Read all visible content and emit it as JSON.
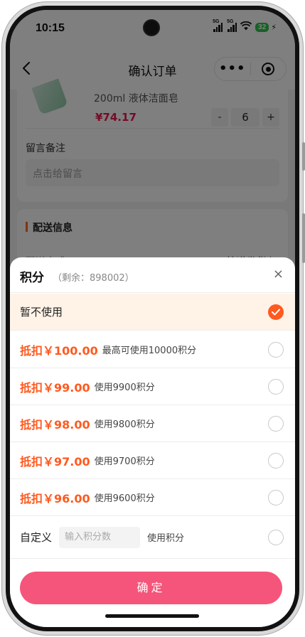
{
  "status_bar": {
    "time": "10:15",
    "network_1": "5G",
    "network_2": "5G",
    "battery": "32"
  },
  "nav": {
    "title": "确认订单",
    "more_label": "•••"
  },
  "background": {
    "product_name": "200ml 液体洁面皂",
    "product_price": "¥74.17",
    "quantity": "6",
    "minus": "-",
    "plus": "+",
    "remark_label": "留言备注",
    "remark_placeholder": "点击给留言",
    "delivery_section_title": "配送信息",
    "delivery_method_label": "配送方式",
    "delivery_method_value": "快递发货 〉"
  },
  "sheet": {
    "title": "积分",
    "remaining": "（剩余：898002）",
    "close": "×",
    "no_use_label": "暂不使用",
    "options": [
      {
        "amount": "抵扣￥100.00",
        "desc": "最高可使用10000积分"
      },
      {
        "amount": "抵扣￥99.00",
        "desc": "使用9900积分"
      },
      {
        "amount": "抵扣￥98.00",
        "desc": "使用9800积分"
      },
      {
        "amount": "抵扣￥97.00",
        "desc": "使用9700积分"
      },
      {
        "amount": "抵扣￥96.00",
        "desc": "使用9600积分"
      }
    ],
    "custom_label": "自定义",
    "custom_placeholder": "输入积分数",
    "custom_value": "",
    "custom_suffix": "使用积分",
    "confirm_label": "确定"
  },
  "colors": {
    "accent": "#ff5a1f",
    "price_red": "#e8174f",
    "confirm_pink": "#f5557a",
    "selected_bg": "#fff3e8"
  }
}
